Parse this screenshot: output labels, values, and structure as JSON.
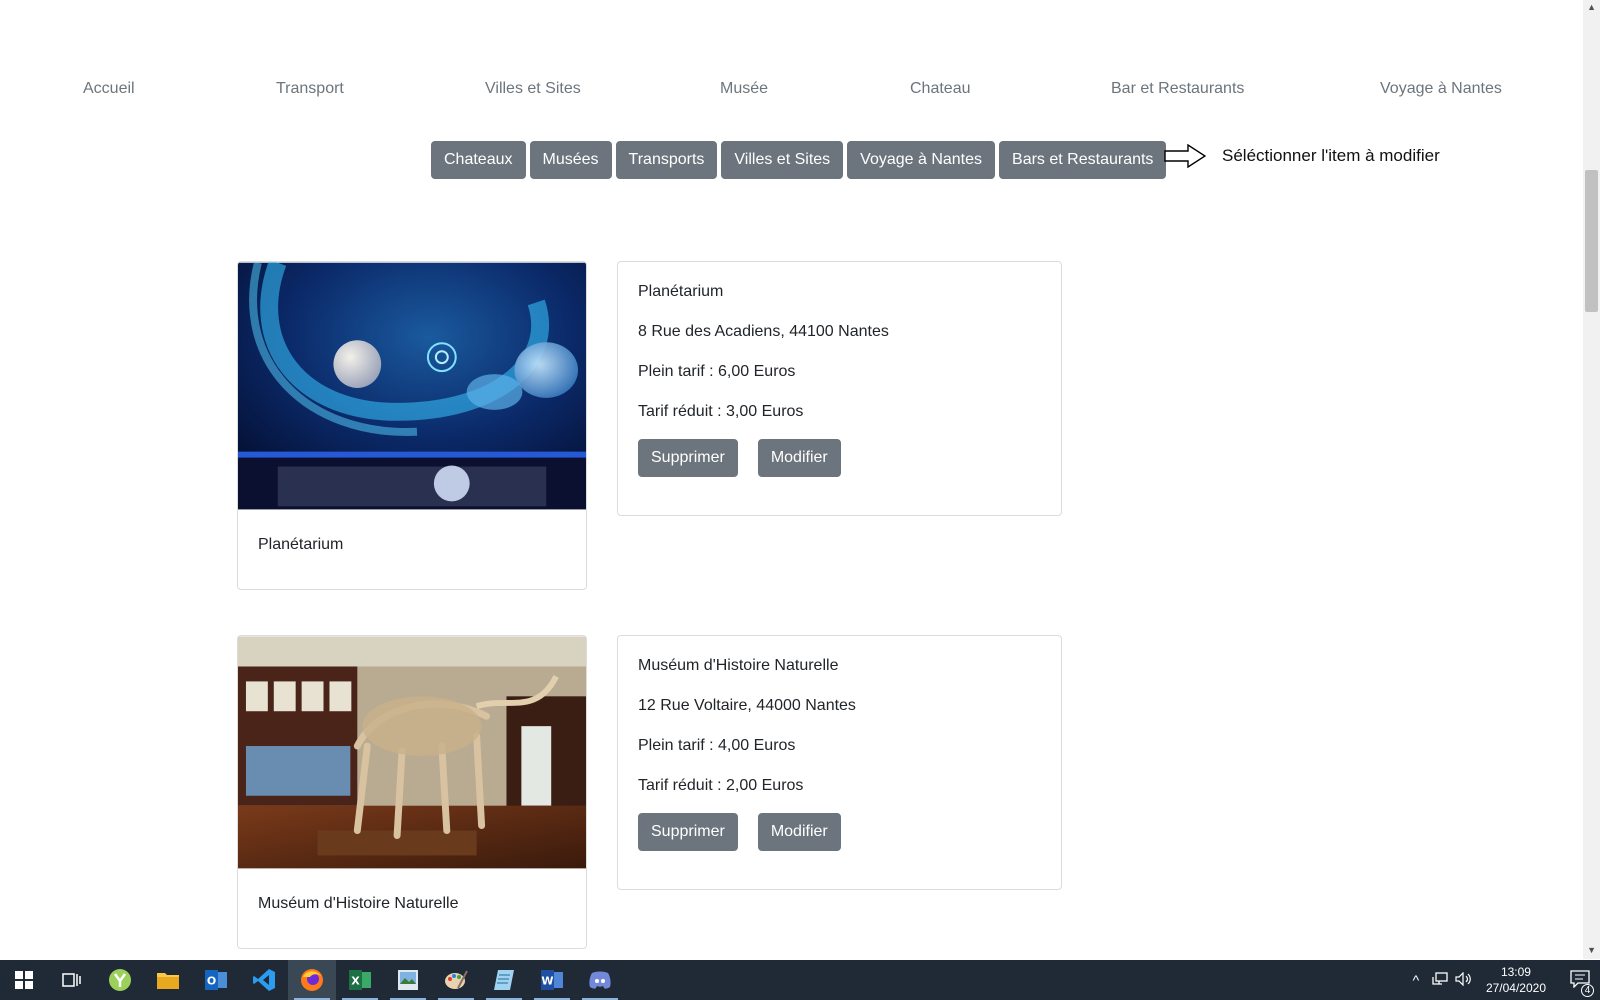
{
  "nav": {
    "items": [
      "Accueil",
      "Transport",
      "Villes et Sites",
      "Musée",
      "Chateau",
      "Bar et Restaurants",
      "Voyage à Nantes"
    ]
  },
  "categories": [
    "Chateaux",
    "Musées",
    "Transports",
    "Villes et Sites",
    "Voyage à Nantes",
    "Bars et Restaurants"
  ],
  "hint": "Séléctionner l'item à modifier",
  "items": [
    {
      "card_title": "Planétarium",
      "name": "Planétarium",
      "address": "8 Rue des Acadiens, 44100 Nantes",
      "full_price": "Plein tarif : 6,00 Euros",
      "reduced_price": "Tarif réduit : 3,00 Euros",
      "delete_label": "Supprimer",
      "edit_label": "Modifier"
    },
    {
      "card_title": "Muséum d'Histoire Naturelle",
      "name": "Muséum d'Histoire Naturelle",
      "address": "12 Rue Voltaire, 44000 Nantes",
      "full_price": "Plein tarif : 4,00 Euros",
      "reduced_price": "Tarif réduit : 2,00 Euros",
      "delete_label": "Supprimer",
      "edit_label": "Modifier"
    }
  ],
  "taskbar": {
    "time": "13:09",
    "date": "27/04/2020",
    "notification_count": "4",
    "apps": [
      "start-icon",
      "task-view-icon",
      "browser-y-icon",
      "file-explorer-icon",
      "outlook-icon",
      "vscode-icon",
      "firefox-icon",
      "excel-icon",
      "photo-viewer-icon",
      "paint-icon",
      "notepad-icon",
      "word-icon",
      "discord-icon"
    ]
  },
  "colors": {
    "button_bg": "#6c757d",
    "nav_text": "#6c757d",
    "taskbar_bg": "#1f2a36"
  }
}
